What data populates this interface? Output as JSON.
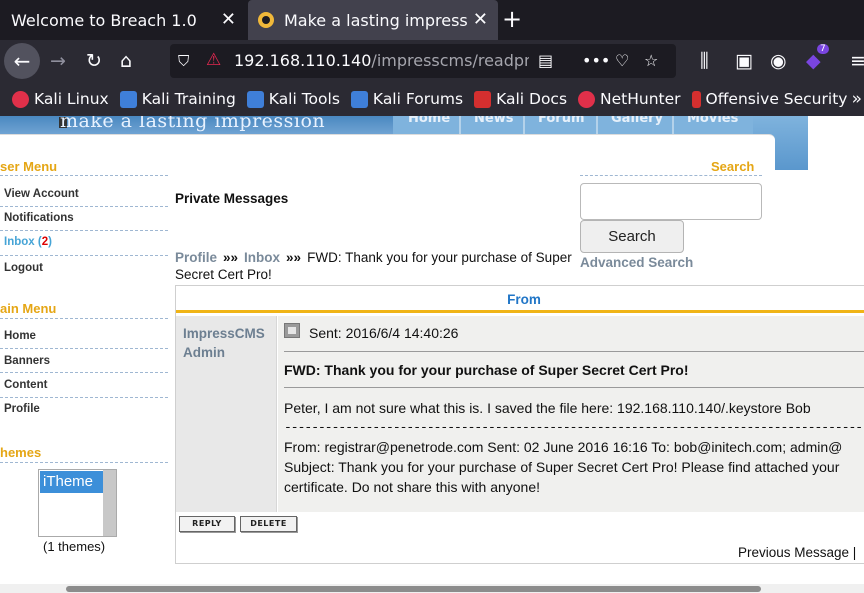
{
  "browser": {
    "tabs": [
      {
        "title": "Welcome to Breach 1.0",
        "close": "✕"
      },
      {
        "title": "Make a lasting impression",
        "close": "✕"
      }
    ],
    "new_tab": "+",
    "url_host": "192.168.110.140",
    "url_path": "/impresscms/readpms",
    "bookmarks": [
      {
        "label": "Kali Linux",
        "icon": "kali-dragon-icon"
      },
      {
        "label": "Kali Training",
        "icon": "kali-training-icon"
      },
      {
        "label": "Kali Tools",
        "icon": "kali-tools-icon"
      },
      {
        "label": "Kali Forums",
        "icon": "kali-forums-icon"
      },
      {
        "label": "Kali Docs",
        "icon": "kali-docs-icon"
      },
      {
        "label": "NetHunter",
        "icon": "nethunter-icon"
      },
      {
        "label": "Offensive Security",
        "icon": "offsec-icon"
      }
    ],
    "bookmarks_more": "»",
    "extension_badge": "7"
  },
  "site": {
    "slogan": "make a lasting impression",
    "nav": [
      "Home",
      "News",
      "Forum",
      "Gallery",
      "Movies"
    ]
  },
  "user_menu": {
    "title": "ser Menu",
    "items": [
      {
        "label": "View Account"
      },
      {
        "label": "Notifications"
      },
      {
        "label": "Inbox",
        "count_open": "(",
        "count": "2",
        "count_close": ")"
      },
      {
        "label": "Logout"
      }
    ]
  },
  "main_menu": {
    "title": "ain Menu",
    "items": [
      "Home",
      "Banners",
      "Content",
      "Profile"
    ]
  },
  "themes": {
    "title": "hemes",
    "options": [
      "iTheme"
    ],
    "count_text": "(1 themes)"
  },
  "search": {
    "title": "Search",
    "placeholder": "",
    "button": "Search",
    "advanced": "Advanced Search"
  },
  "content": {
    "heading": "Private Messages",
    "breadcrumb": {
      "profile": "Profile",
      "sep": "»»",
      "inbox": "Inbox",
      "subject": "FWD: Thank you for your purchase of Super Secret Cert Pro!"
    }
  },
  "message": {
    "from_header": "From",
    "author_line1": "ImpressCMS",
    "author_line2": "Admin",
    "sent": "Sent: 2016/6/4 14:40:26",
    "subject": "FWD: Thank you for your purchase of Super Secret Cert Pro!",
    "body_line1": "Peter, I am not sure what this is. I saved the file here: 192.168.110.140/.keystore Bob",
    "separator": "-------------------------------------------------------------------------------------------------------------------------",
    "fwd_line1": "From: registrar@penetrode.com Sent: 02 June 2016 16:16 To: bob@initech.com; admin@",
    "fwd_line2": "Subject: Thank you for your purchase of Super Secret Cert Pro! Please find attached your",
    "fwd_line3": "certificate. Do not share this with anyone!",
    "reply_button": "REPLY",
    "delete_button": "DELETE",
    "prev_message": "Previous Message |"
  }
}
